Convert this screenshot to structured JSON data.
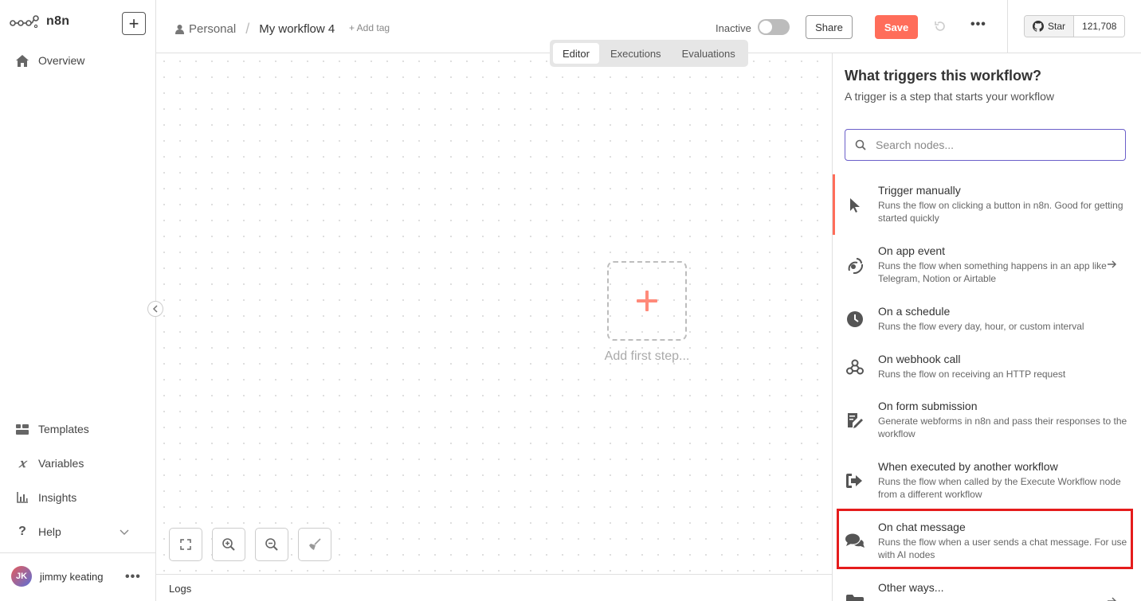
{
  "app": {
    "logo_text": "n8n",
    "new_label": "+"
  },
  "sidebar": {
    "top_items": [
      {
        "label": "Overview",
        "icon": "home-icon"
      }
    ],
    "bottom_items": [
      {
        "label": "Templates",
        "icon": "templates-icon"
      },
      {
        "label": "Variables",
        "icon": "variables-icon"
      },
      {
        "label": "Insights",
        "icon": "insights-icon"
      },
      {
        "label": "Help",
        "icon": "help-icon"
      }
    ],
    "user": {
      "initials": "JK",
      "name": "jimmy keating"
    }
  },
  "header": {
    "project": "Personal",
    "workflow_name": "My workflow 4",
    "add_tag": "+ Add tag",
    "status_label": "Inactive",
    "active": false,
    "share_label": "Share",
    "save_label": "Save",
    "star_label": "Star",
    "star_count": "121,708"
  },
  "tabs": [
    {
      "label": "Editor",
      "active": true
    },
    {
      "label": "Executions",
      "active": false
    },
    {
      "label": "Evaluations",
      "active": false
    }
  ],
  "canvas": {
    "add_first_step": "Add first step..."
  },
  "logs": {
    "label": "Logs"
  },
  "panel": {
    "title": "What triggers this workflow?",
    "subtitle": "A trigger is a step that starts your workflow",
    "search_placeholder": "Search nodes...",
    "items": [
      {
        "title": "Trigger manually",
        "desc": "Runs the flow on clicking a button in n8n. Good for getting started quickly",
        "icon": "cursor-icon",
        "selected": true
      },
      {
        "title": "On app event",
        "desc": "Runs the flow when something happens in an app like Telegram, Notion or Airtable",
        "icon": "app-event-icon",
        "has_arrow": true
      },
      {
        "title": "On a schedule",
        "desc": "Runs the flow every day, hour, or custom interval",
        "icon": "clock-icon"
      },
      {
        "title": "On webhook call",
        "desc": "Runs the flow on receiving an HTTP request",
        "icon": "webhook-icon"
      },
      {
        "title": "On form submission",
        "desc": "Generate webforms in n8n and pass their responses to the workflow",
        "icon": "form-icon"
      },
      {
        "title": "When executed by another workflow",
        "desc": "Runs the flow when called by the Execute Workflow node from a different workflow",
        "icon": "sign-in-icon"
      },
      {
        "title": "On chat message",
        "desc": "Runs the flow when a user sends a chat message. For use with AI nodes",
        "icon": "chat-icon"
      },
      {
        "title": "Other ways...",
        "desc": "",
        "icon": "folder-icon",
        "has_arrow": true
      }
    ]
  },
  "colors": {
    "accent": "#ff6d5a",
    "search_border": "#6b5fc9",
    "highlight": "#e51c1c"
  }
}
